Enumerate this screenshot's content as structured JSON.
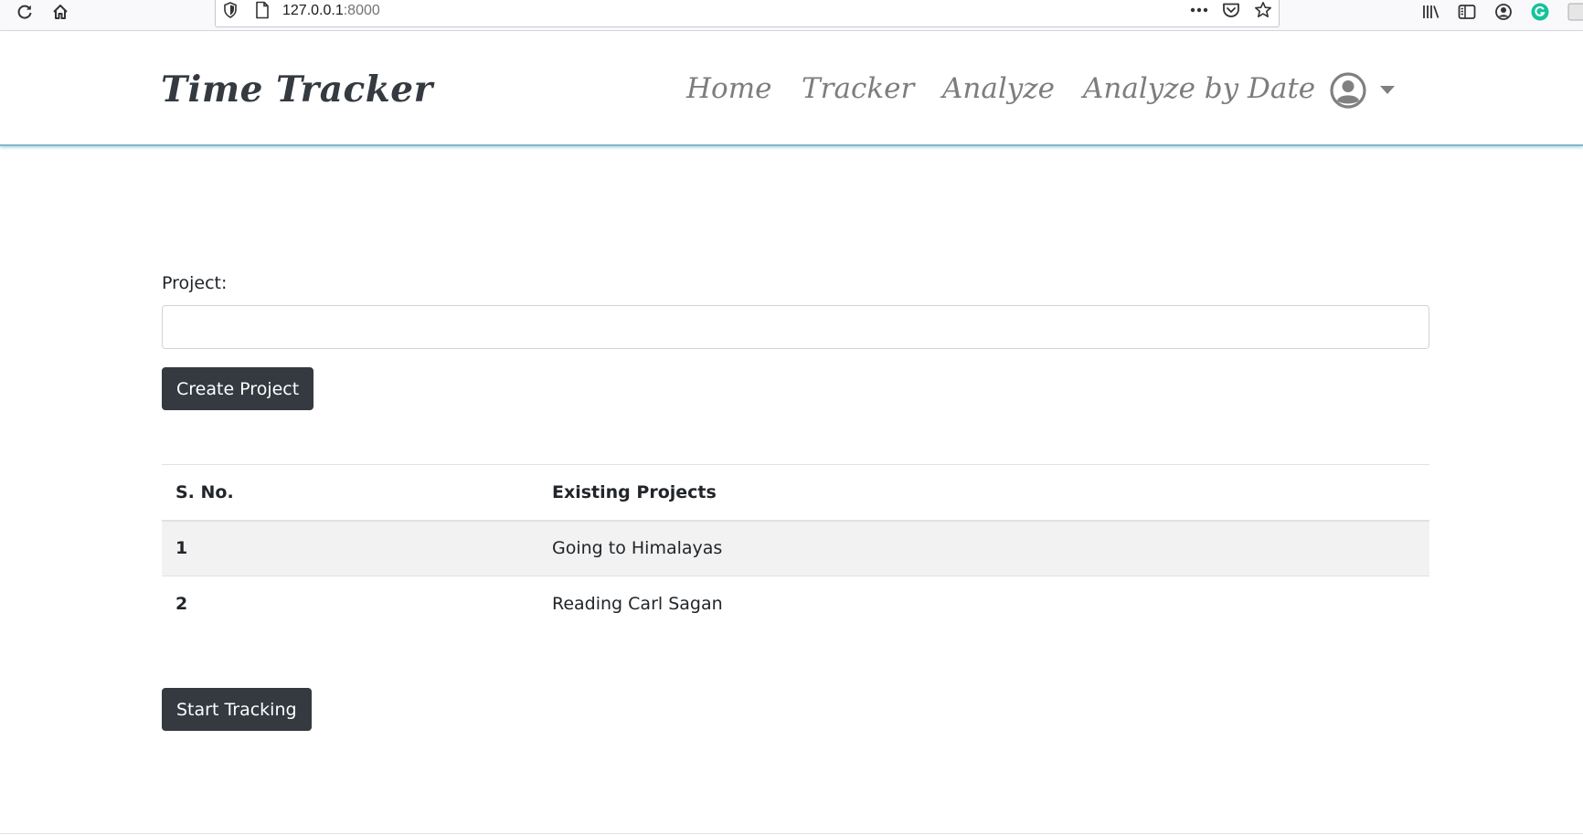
{
  "browser": {
    "url_host": "127.0.0.1",
    "url_port": ":8000",
    "icons": {
      "reload": "reload-icon",
      "home": "home-icon",
      "shield": "shield-icon",
      "page": "page-icon",
      "more": "more-icon",
      "pocket": "pocket-icon",
      "bookmark": "star-icon",
      "library": "library-icon",
      "sidebar": "sidebar-icon",
      "account": "account-icon",
      "grammarly": "grammarly-icon"
    },
    "accent_grammarly": "#15c39a"
  },
  "navbar": {
    "brand": "Time Tracker",
    "links": [
      "Home",
      "Tracker",
      "Analyze",
      "Analyze by Date"
    ],
    "user_icon": "user-circle-icon",
    "border_color": "#7fb8cc"
  },
  "form": {
    "label": "Project:",
    "input_value": "",
    "input_placeholder": "",
    "create_button": "Create Project"
  },
  "table": {
    "headers": [
      "S. No.",
      "Existing Projects"
    ],
    "rows": [
      {
        "sno": "1",
        "name": "Going to Himalayas"
      },
      {
        "sno": "2",
        "name": "Reading Carl Sagan"
      }
    ]
  },
  "actions": {
    "start_button": "Start Tracking"
  },
  "colors": {
    "button_bg": "#343a40",
    "brand_text": "#343a40",
    "nav_text": "#7d7d7d",
    "striped_row": "#f2f2f2"
  }
}
